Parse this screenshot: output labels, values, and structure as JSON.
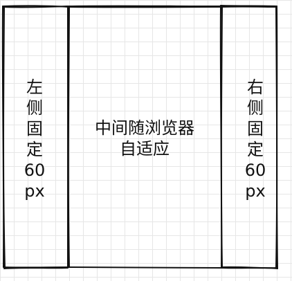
{
  "left_column": {
    "lines": [
      "左",
      "侧",
      "固",
      "定",
      "60",
      "px"
    ]
  },
  "middle_column": {
    "lines": [
      "中间随浏览器",
      "自适应"
    ]
  },
  "right_column": {
    "lines": [
      "右",
      "侧",
      "固",
      "定",
      "60",
      "px"
    ]
  },
  "colors": {
    "stroke": "#111111",
    "grid": "#e6e6e6",
    "background": "#ffffff"
  }
}
